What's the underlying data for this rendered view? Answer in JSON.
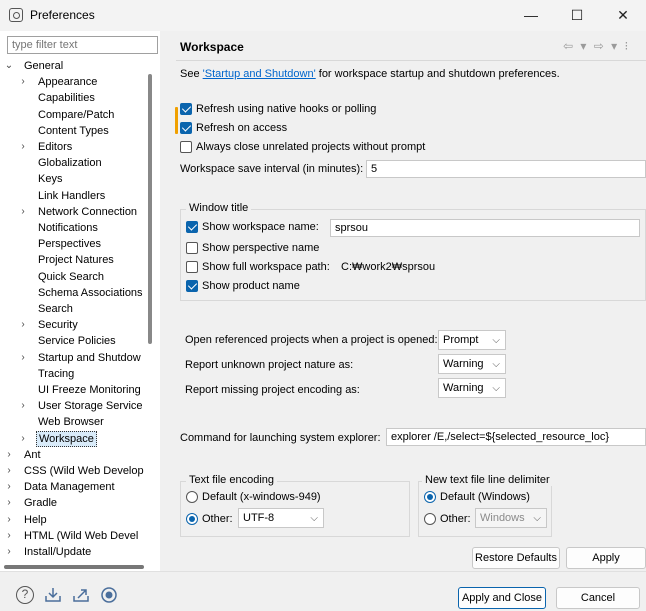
{
  "window": {
    "title": "Preferences",
    "minimize": "—",
    "maximize": "☐",
    "close": "✕"
  },
  "filter": {
    "placeholder": "type filter text"
  },
  "tree": [
    {
      "label": "General",
      "arrow": "⌄",
      "level": 0
    },
    {
      "label": "Appearance",
      "arrow": "›",
      "level": 1
    },
    {
      "label": "Capabilities",
      "arrow": "",
      "level": 1
    },
    {
      "label": "Compare/Patch",
      "arrow": "",
      "level": 1
    },
    {
      "label": "Content Types",
      "arrow": "",
      "level": 1
    },
    {
      "label": "Editors",
      "arrow": "›",
      "level": 1
    },
    {
      "label": "Globalization",
      "arrow": "",
      "level": 1
    },
    {
      "label": "Keys",
      "arrow": "",
      "level": 1
    },
    {
      "label": "Link Handlers",
      "arrow": "",
      "level": 1
    },
    {
      "label": "Network Connection",
      "arrow": "›",
      "level": 1
    },
    {
      "label": "Notifications",
      "arrow": "",
      "level": 1
    },
    {
      "label": "Perspectives",
      "arrow": "",
      "level": 1
    },
    {
      "label": "Project Natures",
      "arrow": "",
      "level": 1
    },
    {
      "label": "Quick Search",
      "arrow": "",
      "level": 1
    },
    {
      "label": "Schema Associations",
      "arrow": "",
      "level": 1
    },
    {
      "label": "Search",
      "arrow": "",
      "level": 1
    },
    {
      "label": "Security",
      "arrow": "›",
      "level": 1
    },
    {
      "label": "Service Policies",
      "arrow": "",
      "level": 1
    },
    {
      "label": "Startup and Shutdow",
      "arrow": "›",
      "level": 1
    },
    {
      "label": "Tracing",
      "arrow": "",
      "level": 1
    },
    {
      "label": "UI Freeze Monitoring",
      "arrow": "",
      "level": 1
    },
    {
      "label": "User Storage Service",
      "arrow": "›",
      "level": 1
    },
    {
      "label": "Web Browser",
      "arrow": "",
      "level": 1
    },
    {
      "label": "Workspace",
      "arrow": "›",
      "level": 1,
      "selected": true
    },
    {
      "label": "Ant",
      "arrow": "›",
      "level": 0
    },
    {
      "label": "CSS (Wild Web Develop",
      "arrow": "›",
      "level": 0
    },
    {
      "label": "Data Management",
      "arrow": "›",
      "level": 0
    },
    {
      "label": "Gradle",
      "arrow": "›",
      "level": 0
    },
    {
      "label": "Help",
      "arrow": "›",
      "level": 0
    },
    {
      "label": "HTML (Wild Web Devel",
      "arrow": "›",
      "level": 0
    },
    {
      "label": "Install/Update",
      "arrow": "›",
      "level": 0
    }
  ],
  "page": {
    "title": "Workspace",
    "nav_arrows": "⇦ ▾ ⇨ ▾ ⁝",
    "intro_prefix": "See ",
    "intro_link": "'Startup and Shutdown'",
    "intro_suffix": " for workspace startup and shutdown preferences.",
    "refresh_native": {
      "label": "Refresh using native hooks or polling",
      "checked": true
    },
    "refresh_access": {
      "label": "Refresh on access",
      "checked": true
    },
    "close_unrelated": {
      "label": "Always close unrelated projects without prompt",
      "checked": false
    },
    "save_interval": {
      "label": "Workspace save interval (in minutes):",
      "value": "5"
    },
    "window_title": {
      "group": "Window title",
      "show_workspace_name": {
        "label": "Show workspace name:",
        "checked": true,
        "value": "sprsou"
      },
      "show_perspective": {
        "label": "Show perspective name",
        "checked": false
      },
      "show_full_path": {
        "label": "Show full workspace path:",
        "checked": false,
        "value": "C:₩work2₩sprsou"
      },
      "show_product": {
        "label": "Show product name",
        "checked": true
      }
    },
    "open_referenced": {
      "label": "Open referenced projects when a project is opened:",
      "value": "Prompt"
    },
    "unknown_nature": {
      "label": "Report unknown project nature as:",
      "value": "Warning"
    },
    "missing_encoding": {
      "label": "Report missing project encoding as:",
      "value": "Warning"
    },
    "explorer_cmd": {
      "label": "Command for launching system explorer:",
      "value": "explorer /E,/select=${selected_resource_loc}"
    },
    "encoding": {
      "group": "Text file encoding",
      "default_label": "Default (x-windows-949)",
      "other_label": "Other:",
      "other_value": "UTF-8",
      "selected": "other"
    },
    "delimiter": {
      "group": "New text file line delimiter",
      "default_label": "Default (Windows)",
      "other_label": "Other:",
      "other_value": "Windows",
      "selected": "default"
    },
    "restore_defaults": "Restore Defaults",
    "apply": "Apply"
  },
  "footer": {
    "icons": [
      "help-icon",
      "import-icon",
      "export-icon",
      "record-icon"
    ],
    "apply_close": "Apply and Close",
    "cancel": "Cancel"
  }
}
